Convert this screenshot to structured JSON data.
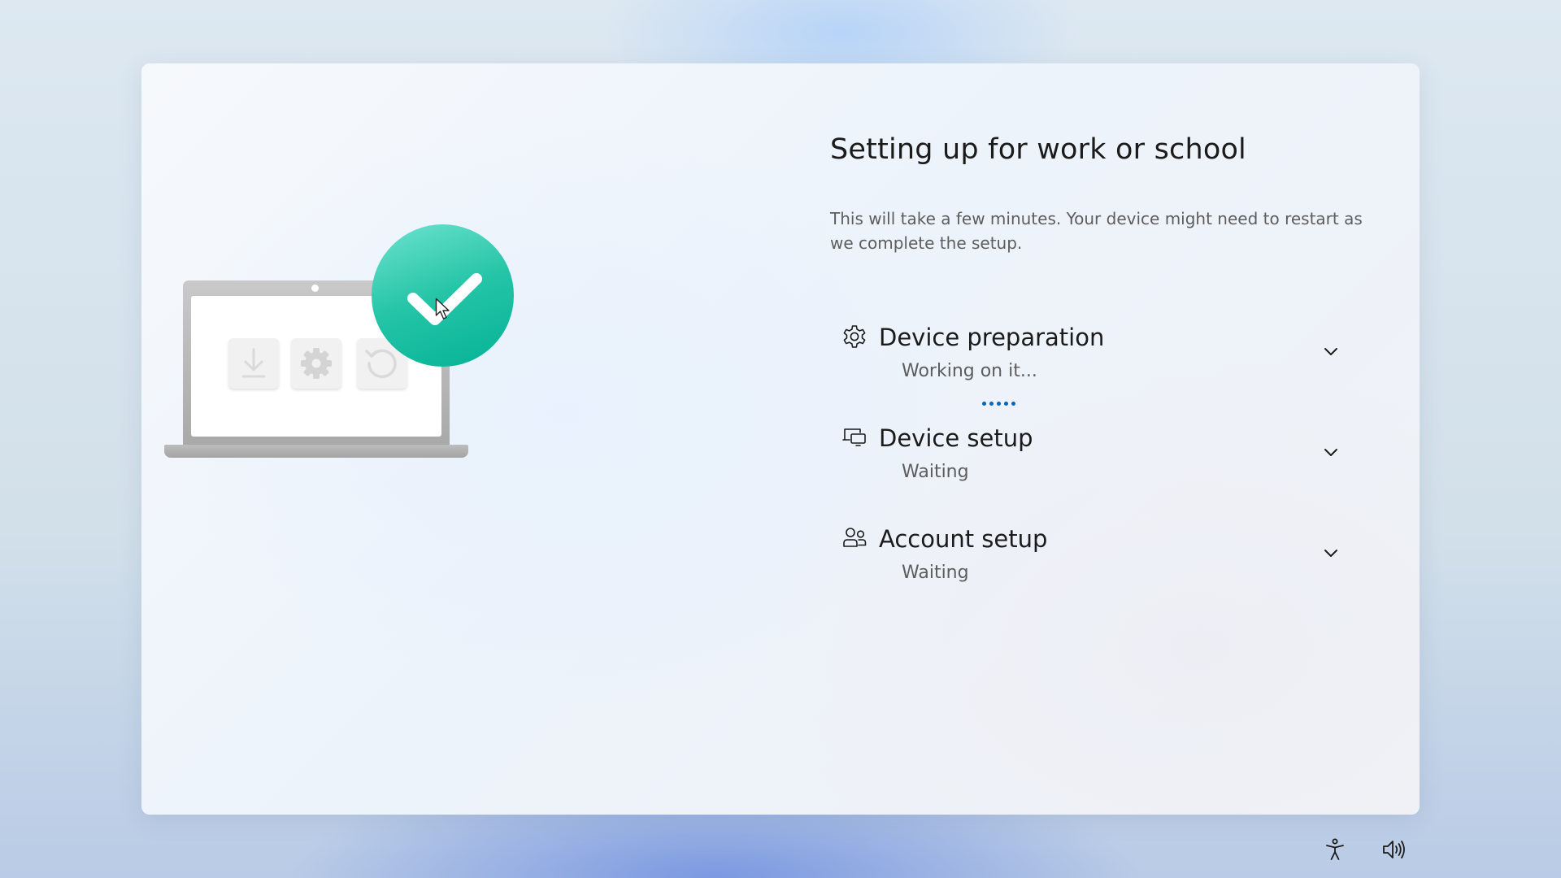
{
  "setup": {
    "title": "Setting up for work or school",
    "description": "This will take a few minutes. Your device might need to restart as we complete the setup."
  },
  "steps": [
    {
      "label": "Device preparation",
      "status": "Working on it...",
      "icon": "gear-icon",
      "expanded": false,
      "in_progress": true
    },
    {
      "label": "Device setup",
      "status": "Waiting",
      "icon": "devices-icon",
      "expanded": false,
      "in_progress": false
    },
    {
      "label": "Account setup",
      "status": "Waiting",
      "icon": "people-icon",
      "expanded": false,
      "in_progress": false
    }
  ],
  "illustration": {
    "tiles": [
      "download-icon",
      "gear-icon",
      "restart-icon"
    ],
    "badge": "checkmark-icon"
  },
  "system_buttons": [
    "accessibility-icon",
    "volume-icon"
  ],
  "colors": {
    "accent": "#0067c0",
    "check_badge": "#1fc3a6",
    "text_primary": "#1b1b1b",
    "text_secondary": "#5d5d5d"
  }
}
